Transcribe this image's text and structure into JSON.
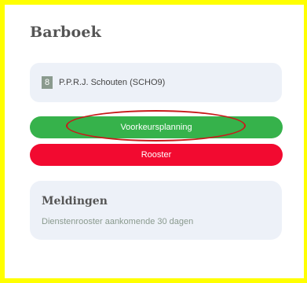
{
  "app": {
    "title": "Barboek"
  },
  "user": {
    "badge": "8",
    "name": "P.P.R.J. Schouten (SCHO9)"
  },
  "actions": {
    "preference_label": "Voorkeursplanning",
    "roster_label": "Rooster"
  },
  "notifications": {
    "title": "Meldingen",
    "subtitle": "Dienstenrooster aankomende 30 dagen"
  },
  "colors": {
    "highlight_border": "#ffff00",
    "preference_button": "#36b24b",
    "roster_button": "#f20a30",
    "annotation_ellipse": "#c81a1a"
  }
}
